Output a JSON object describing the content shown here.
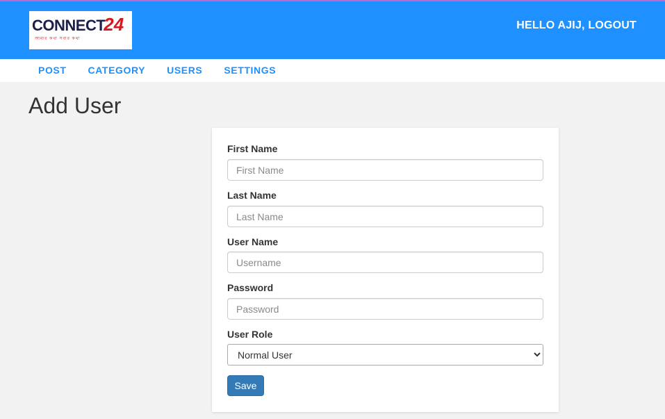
{
  "header": {
    "logo_text": "CONNECT",
    "logo_number": "24",
    "logo_tagline": "আমার কথা সবার কথা",
    "greeting": "HELLO AJIJ,",
    "logout_label": "LOGOUT"
  },
  "nav": {
    "items": [
      {
        "label": "POST"
      },
      {
        "label": "CATEGORY"
      },
      {
        "label": "USERS"
      },
      {
        "label": "SETTINGS"
      }
    ]
  },
  "page": {
    "title": "Add User"
  },
  "form": {
    "first_name": {
      "label": "First Name",
      "placeholder": "First Name",
      "value": ""
    },
    "last_name": {
      "label": "Last Name",
      "placeholder": "Last Name",
      "value": ""
    },
    "user_name": {
      "label": "User Name",
      "placeholder": "Username",
      "value": ""
    },
    "password": {
      "label": "Password",
      "placeholder": "Password",
      "value": ""
    },
    "user_role": {
      "label": "User Role",
      "selected": "Normal User",
      "options": [
        "Normal User"
      ]
    },
    "save_label": "Save"
  },
  "colors": {
    "header_bg": "#1e90ff",
    "nav_link": "#1e90ff",
    "button_primary": "#337ab7",
    "page_bg": "#f2f2f2"
  }
}
